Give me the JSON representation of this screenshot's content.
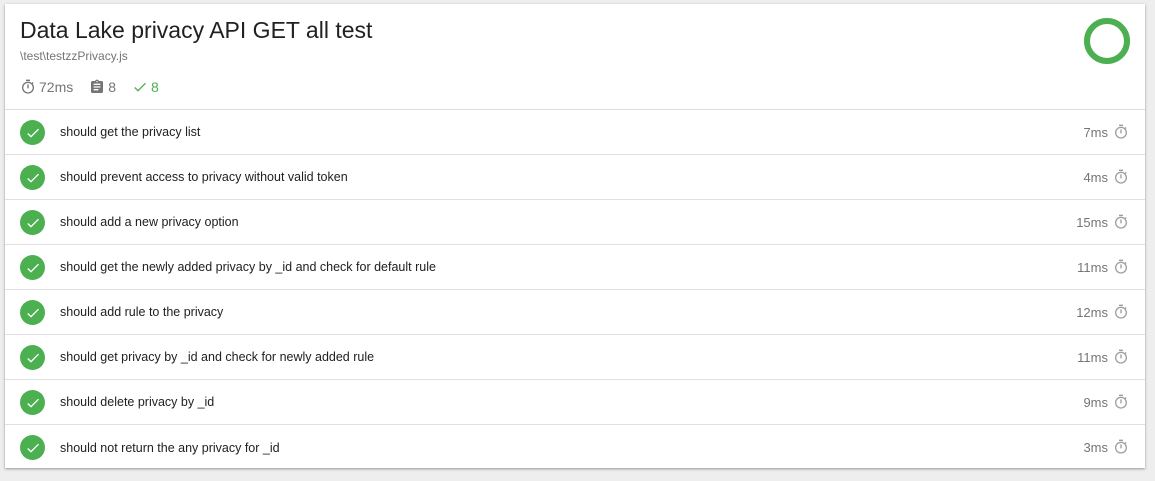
{
  "suite": {
    "title": "Data Lake privacy API GET all test",
    "filename": "\\test\\testzzPrivacy.js",
    "duration": "72ms",
    "total_tests": "8",
    "passes": "8",
    "pass_percent": 100
  },
  "colors": {
    "pass": "#4caf50",
    "muted": "#757575"
  },
  "icons": {
    "duration": "stopwatch-icon",
    "tests": "clipboard-icon",
    "passes": "checkmark-icon",
    "status": "check-circle-icon"
  },
  "tests": [
    {
      "title": "should get the privacy list",
      "duration": "7ms"
    },
    {
      "title": "should prevent access to privacy without valid token",
      "duration": "4ms"
    },
    {
      "title": "should add a new privacy option",
      "duration": "15ms"
    },
    {
      "title": "should get the newly added privacy by _id and check for default rule",
      "duration": "11ms"
    },
    {
      "title": "should add rule to the privacy",
      "duration": "12ms"
    },
    {
      "title": "should get privacy by _id and check for newly added rule",
      "duration": "11ms"
    },
    {
      "title": "should delete privacy by _id",
      "duration": "9ms"
    },
    {
      "title": "should not return the any privacy for _id",
      "duration": "3ms"
    }
  ]
}
